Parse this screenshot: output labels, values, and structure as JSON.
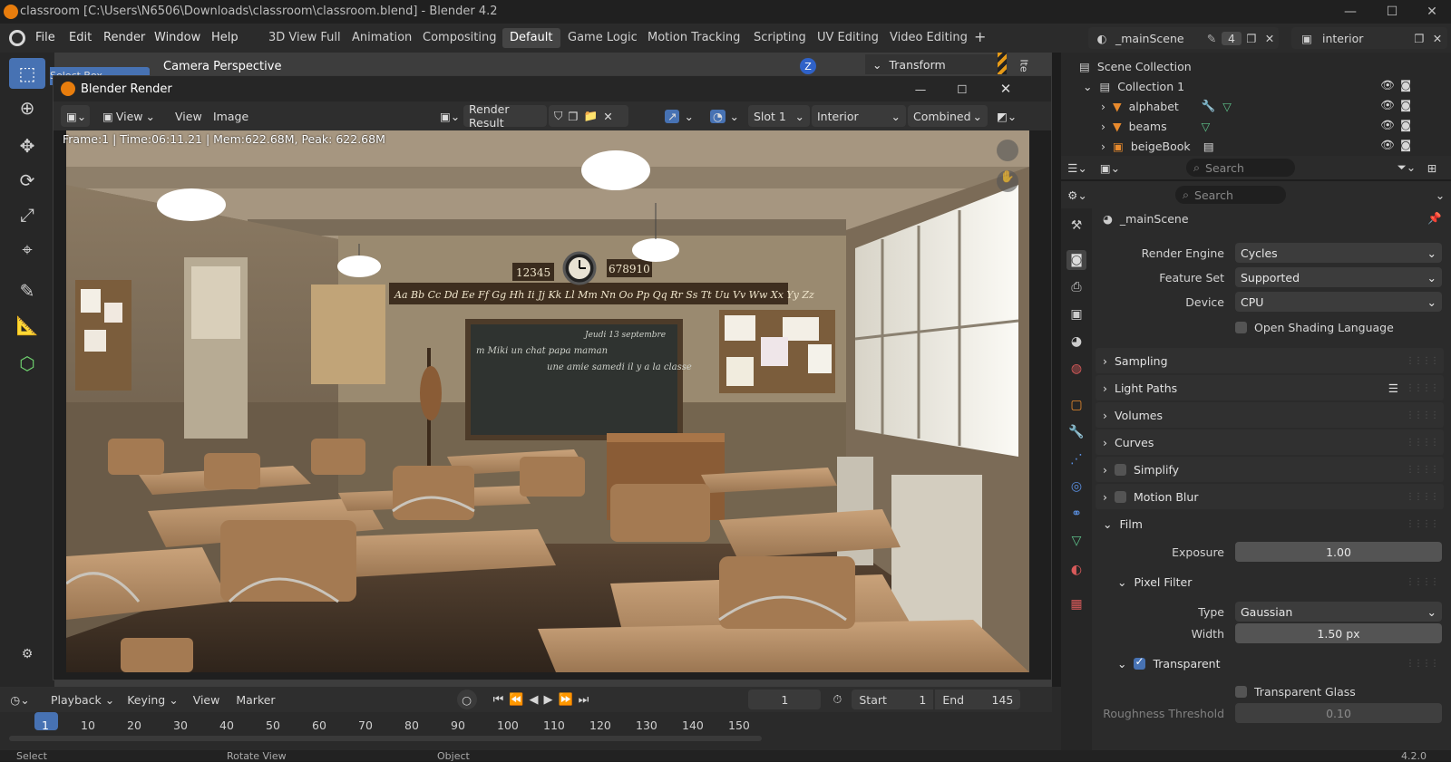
{
  "window": {
    "title": "classroom [C:\\Users\\N6506\\Downloads\\classroom\\classroom.blend] - Blender 4.2",
    "min": "—",
    "max": "☐",
    "close": "✕"
  },
  "menus": [
    "File",
    "Edit",
    "Render",
    "Window",
    "Help"
  ],
  "workspaces": [
    "3D View Full",
    "Animation",
    "Compositing",
    "Default",
    "Game Logic",
    "Motion Tracking",
    "Scripting",
    "UV Editing",
    "Video Editing"
  ],
  "active_workspace": "Default",
  "add_workspace": "+",
  "scene": {
    "name": "_mainScene",
    "users": "4",
    "view_layer": "interior"
  },
  "viewport": {
    "tool_hint": "Select Box",
    "camera": "Camera Perspective",
    "transform": "Transform",
    "item_tab": "Ite"
  },
  "render_window": {
    "title": "Blender Render",
    "menus": [
      "View",
      "View",
      "Image"
    ],
    "image_name": "Render Result",
    "slot": "Slot 1",
    "layer": "Interior",
    "pass": "Combined",
    "info": "Frame:1 | Time:06:11.21 | Mem:622.68M, Peak: 622.68M"
  },
  "scene_image": {
    "numbers_left": "12345",
    "numbers_right": "678910",
    "alphabet": "Aa Bb   Cc Dd Ee Ff Gg Hh Ii Jj Kk Ll Mm Nn Oo Pp Qq Rr Ss Tt Uu Vv Ww Xx Yy Zz",
    "board_left": "m Miki  un chat  papa  maman",
    "board_mid": "une amie  samedi  il y a  la classe",
    "board_date": "Jeudi 13 septembre"
  },
  "outliner": {
    "root": "Scene Collection",
    "collection": "Collection 1",
    "items": [
      "alphabet",
      "beams",
      "beigeBook"
    ],
    "search_placeholder": "Search"
  },
  "properties": {
    "search_placeholder": "Search",
    "scene_name": "_mainScene",
    "render_engine_label": "Render Engine",
    "render_engine": "Cycles",
    "feature_set_label": "Feature Set",
    "feature_set": "Supported",
    "device_label": "Device",
    "device": "CPU",
    "osl": "Open Shading Language",
    "panels": [
      "Sampling",
      "Light Paths",
      "Volumes",
      "Curves",
      "Simplify",
      "Motion Blur",
      "Film"
    ],
    "exposure_label": "Exposure",
    "exposure": "1.00",
    "pixel_filter": "Pixel Filter",
    "type_label": "Type",
    "type": "Gaussian",
    "width_label": "Width",
    "width": "1.50 px",
    "transparent": "Transparent",
    "transparent_glass": "Transparent Glass",
    "roughness_label": "Roughness Threshold",
    "roughness": "0.10"
  },
  "timeline": {
    "menus": [
      "Playback",
      "Keying",
      "View",
      "Marker"
    ],
    "current_frame": "1",
    "start_label": "Start",
    "start": "1",
    "end_label": "End",
    "end": "145",
    "frames": [
      "1",
      "10",
      "20",
      "30",
      "40",
      "50",
      "60",
      "70",
      "80",
      "90",
      "100",
      "110",
      "120",
      "130",
      "140",
      "150"
    ]
  },
  "statusbar": {
    "select": "Select",
    "rotate": "Rotate View",
    "object": "Object",
    "version": "4.2.0"
  },
  "colors": {
    "accent": "#4772b3",
    "blender_orange": "#e87d0d",
    "active_tab": "#454545"
  }
}
